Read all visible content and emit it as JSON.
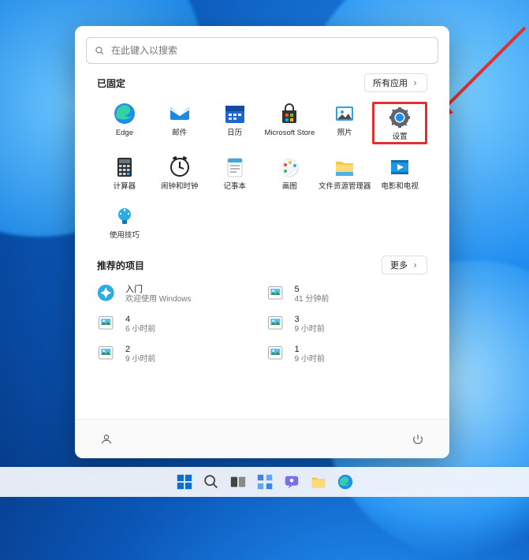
{
  "search": {
    "placeholder": "在此键入以搜索"
  },
  "pinned": {
    "title": "已固定",
    "all_apps": "所有应用",
    "apps": [
      {
        "name": "Edge",
        "icon": "edge"
      },
      {
        "name": "邮件",
        "icon": "mail"
      },
      {
        "name": "日历",
        "icon": "calendar"
      },
      {
        "name": "Microsoft Store",
        "icon": "store"
      },
      {
        "name": "照片",
        "icon": "photos"
      },
      {
        "name": "设置",
        "icon": "settings",
        "highlight": true
      },
      {
        "name": "计算器",
        "icon": "calculator"
      },
      {
        "name": "闹钟和时钟",
        "icon": "clock"
      },
      {
        "name": "记事本",
        "icon": "notepad"
      },
      {
        "name": "画图",
        "icon": "paint"
      },
      {
        "name": "文件资源管理器",
        "icon": "explorer"
      },
      {
        "name": "电影和电视",
        "icon": "movies"
      },
      {
        "name": "使用技巧",
        "icon": "tips"
      }
    ]
  },
  "recommended": {
    "title": "推荐的项目",
    "more": "更多",
    "items": [
      {
        "title": "入门",
        "sub": "欢迎使用 Windows",
        "icon": "getstarted"
      },
      {
        "title": "5",
        "sub": "41 分钟前",
        "icon": "image"
      },
      {
        "title": "4",
        "sub": "6 小时前",
        "icon": "image"
      },
      {
        "title": "3",
        "sub": "9 小时前",
        "icon": "image"
      },
      {
        "title": "2",
        "sub": "9 小时前",
        "icon": "image"
      },
      {
        "title": "1",
        "sub": "9 小时前",
        "icon": "image"
      }
    ]
  },
  "footer": {
    "user": "user-button",
    "power": "power-button"
  },
  "taskbar": [
    "start",
    "search",
    "taskview",
    "widgets",
    "chat",
    "explorer",
    "edge"
  ]
}
